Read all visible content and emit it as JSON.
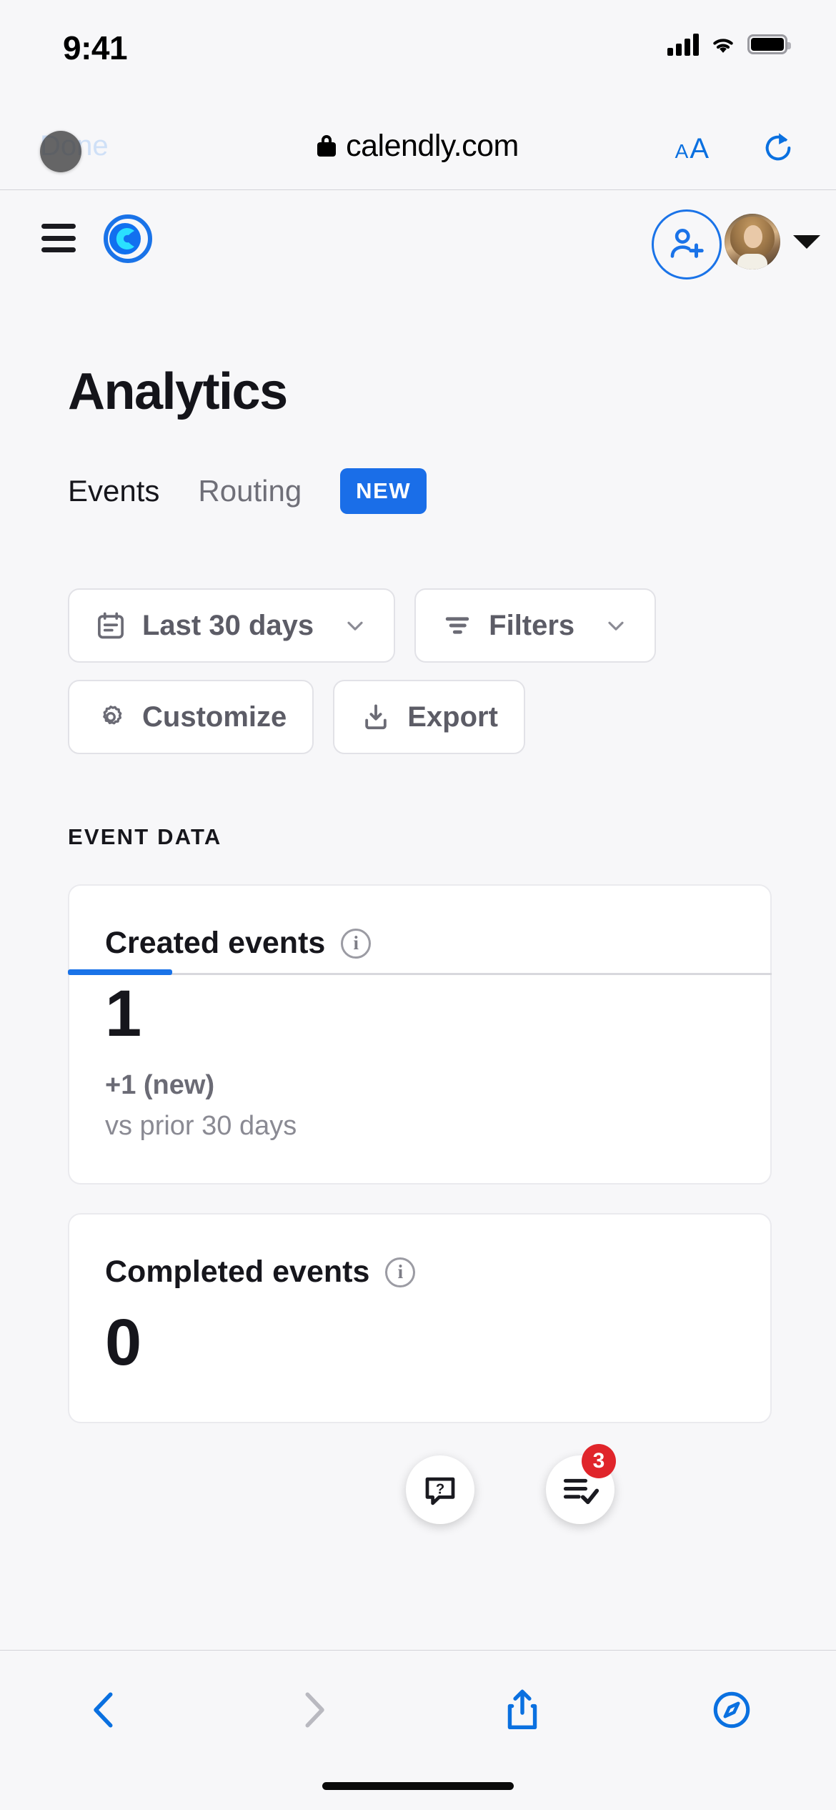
{
  "status_bar": {
    "time": "9:41",
    "cellular_icon": "signal-bars-icon",
    "wifi_icon": "wifi-icon",
    "battery_icon": "battery-full-icon"
  },
  "browser_bar": {
    "done_label": "Done",
    "lock_icon": "lock-icon",
    "url": "calendly.com",
    "text_size_small": "A",
    "text_size_large": "A",
    "reload_icon": "reload-icon"
  },
  "app_nav": {
    "menu_icon": "hamburger-menu-icon",
    "logo_icon": "calendly-logo-icon",
    "invite_icon": "add-user-icon",
    "avatar_icon": "user-avatar",
    "account_caret_icon": "caret-down-icon"
  },
  "page": {
    "title": "Analytics",
    "tabs": [
      {
        "label": "Events",
        "active": true
      },
      {
        "label": "Routing",
        "active": false
      }
    ],
    "routing_badge": "NEW"
  },
  "controls": [
    {
      "label": "Last 30 days",
      "icon": "calendar-icon",
      "chevron": "chevron-down-icon"
    },
    {
      "label": "Filters",
      "icon": "filter-icon",
      "chevron": "chevron-down-icon"
    },
    {
      "label": "Customize",
      "icon": "gear-icon"
    },
    {
      "label": "Export",
      "icon": "download-icon"
    }
  ],
  "section": {
    "label": "EVENT DATA",
    "cards": [
      {
        "title": "Created events",
        "info_icon": "info-icon",
        "value": "1",
        "delta": "+1 (new)",
        "compare": "vs prior 30 days"
      },
      {
        "title": "Completed events",
        "info_icon": "info-icon",
        "value": "0",
        "delta": "",
        "compare": ""
      }
    ]
  },
  "floating_actions": {
    "help_icon": "help-chat-icon",
    "tasks_icon": "checklist-icon",
    "tasks_badge": "3"
  },
  "toolbar": {
    "back_icon": "chevron-left-icon",
    "forward_icon": "chevron-right-icon",
    "share_icon": "share-icon",
    "explore_icon": "compass-icon"
  },
  "colors": {
    "accent": "#1a73e8",
    "badge_red": "#e0252b",
    "page_bg": "#f7f7f9",
    "text_primary": "#16161c",
    "text_muted": "#6f6f78"
  }
}
